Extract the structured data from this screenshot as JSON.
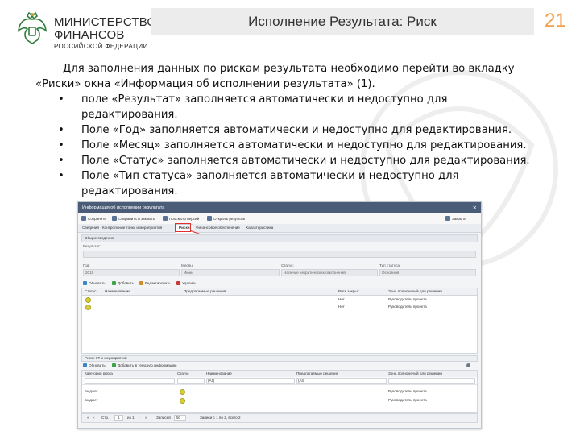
{
  "header": {
    "org_line1": "МИНИСТЕРСТВО",
    "org_line2": "ФИНАНСОВ",
    "org_line3": "РОССИЙСКОЙ ФЕДЕРАЦИИ",
    "title": "Исполнение Результата: Риск",
    "page_number": "21"
  },
  "instructions": {
    "intro": "Для заполнения данных по рискам результата необходимо перейти во вкладку «Риски» окна «Информация об исполнении результата» (1).",
    "bullets": [
      "поле «Результат» заполняется автоматически и недоступно для редактирования.",
      "Поле «Год» заполняется автоматически и недоступно для редактирования.",
      "Поле «Месяц» заполняется автоматически и недоступно для редактирования.",
      "Поле «Статус» заполняется автоматически и недоступно для редактирования.",
      "Поле «Тип статуса» заполняется автоматически и недоступно для редактирования."
    ]
  },
  "window": {
    "title": "Информация об исполнении результата",
    "close_glyph": "✕",
    "toolbar": {
      "save": "Сохранить",
      "save_close": "Сохранить и закрыть",
      "versions": "Просмотр версий",
      "open_result": "Открыть результат",
      "close": "Закрыть"
    },
    "tabs": [
      "Сведения",
      "Контрольные точки и мероприятия",
      "Риски",
      "Финансовое обеспечение",
      "Характеристика"
    ],
    "active_tab_index": 2,
    "marker_label": "1",
    "general": {
      "section_title": "Общие сведения",
      "result_label": "Результат:",
      "result_value": "",
      "year_label": "Год:",
      "year_value": "2019",
      "month_label": "Месяц:",
      "month_value": "Июнь",
      "status_label": "Статус:",
      "status_value": "Наличие некритических отклонений",
      "status_type_label": "Тип статуса:",
      "status_type_value": "Основной"
    },
    "risks_toolbar": {
      "refresh": "Обновить",
      "add": "Добавить",
      "edit": "Редактировать",
      "delete": "Удалить"
    },
    "risks_grid": {
      "columns": [
        "Статус",
        "Наименование",
        "Предлагаемые решения",
        "Риск закрыт",
        "Зона полномочий для решения"
      ],
      "rows": [
        {
          "status_color": "#d6cf3a",
          "name": "",
          "solutions": "",
          "closed": "Нет",
          "zone": "Руководитель проекта"
        },
        {
          "status_color": "#d6cf3a",
          "name": "",
          "solutions": "",
          "closed": "Нет",
          "zone": "Руководитель проекта"
        }
      ]
    },
    "kt": {
      "section_title": "Риски КТ и мероприятий",
      "refresh": "Обновить",
      "add_info": "Добавить в текущую информацию",
      "columns": [
        "Категория риска",
        "Статус",
        "Наименование",
        "Предлагаемые решения",
        "Зона полномочий для решения"
      ],
      "filter_placeholder": "(All)",
      "rows": [
        {
          "category": "Бюджет",
          "status_color": "#d6cf3a",
          "name": "",
          "solutions": "",
          "zone": "Руководитель проекта"
        },
        {
          "category": "Бюджет",
          "status_color": "#d6cf3a",
          "name": "",
          "solutions": "",
          "zone": "Руководитель проекта"
        }
      ]
    },
    "pager": {
      "page_label": "Стр.",
      "page_value": "1",
      "of_pages": "из 1",
      "records_label": "Записей",
      "records_value": "50",
      "range_text": "Записи с 1 по 2, всего 2"
    }
  }
}
